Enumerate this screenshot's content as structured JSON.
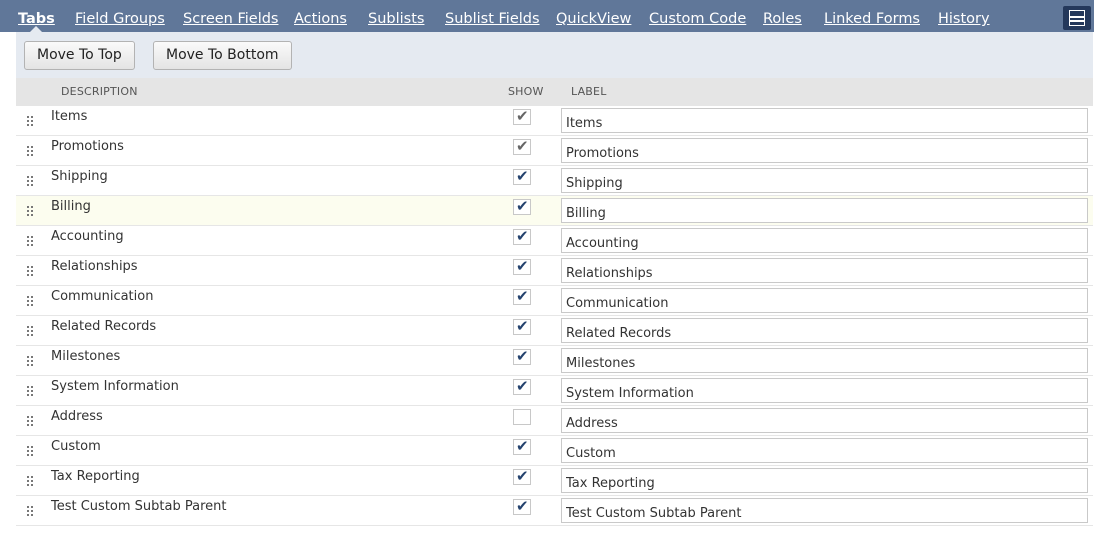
{
  "tabs": [
    {
      "label": "Tabs",
      "active": true
    },
    {
      "label": "Field Groups"
    },
    {
      "label": "Screen Fields"
    },
    {
      "label": "Actions"
    },
    {
      "label": "Sublists"
    },
    {
      "label": "Sublist Fields"
    },
    {
      "label": "QuickView"
    },
    {
      "label": "Custom Code"
    },
    {
      "label": "Roles"
    },
    {
      "label": "Linked Forms"
    },
    {
      "label": "History"
    }
  ],
  "menu_icon": "list-layout-icon",
  "toolbar": {
    "move_top_label": "Move To Top",
    "move_bottom_label": "Move To Bottom"
  },
  "columns": {
    "description": "DESCRIPTION",
    "show": "SHOW",
    "label": "LABEL"
  },
  "checkmark": "✔",
  "colors": {
    "tab_bar": "#607799",
    "menu_button": "#24385b",
    "toolbar_bg": "#e5eaf1",
    "header_bg": "#e5e5e5",
    "check_enabled": "#24426e",
    "check_disabled": "#666666",
    "highlight_row": "#fcfdef"
  },
  "rows": [
    {
      "description": "Items",
      "show": true,
      "locked": true,
      "label": "Items"
    },
    {
      "description": "Promotions",
      "show": true,
      "locked": true,
      "label": "Promotions"
    },
    {
      "description": "Shipping",
      "show": true,
      "label": "Shipping"
    },
    {
      "description": "Billing",
      "show": true,
      "label": "Billing",
      "highlighted": true
    },
    {
      "description": "Accounting",
      "show": true,
      "label": "Accounting"
    },
    {
      "description": "Relationships",
      "show": true,
      "label": "Relationships"
    },
    {
      "description": "Communication",
      "show": true,
      "label": "Communication"
    },
    {
      "description": "Related Records",
      "show": true,
      "label": "Related Records"
    },
    {
      "description": "Milestones",
      "show": true,
      "label": "Milestones"
    },
    {
      "description": "System Information",
      "show": true,
      "label": "System Information"
    },
    {
      "description": "Address",
      "show": false,
      "label": "Address"
    },
    {
      "description": "Custom",
      "show": true,
      "label": "Custom"
    },
    {
      "description": "Tax Reporting",
      "show": true,
      "label": "Tax Reporting"
    },
    {
      "description": "Test Custom Subtab Parent",
      "show": true,
      "label": "Test Custom Subtab Parent"
    }
  ]
}
